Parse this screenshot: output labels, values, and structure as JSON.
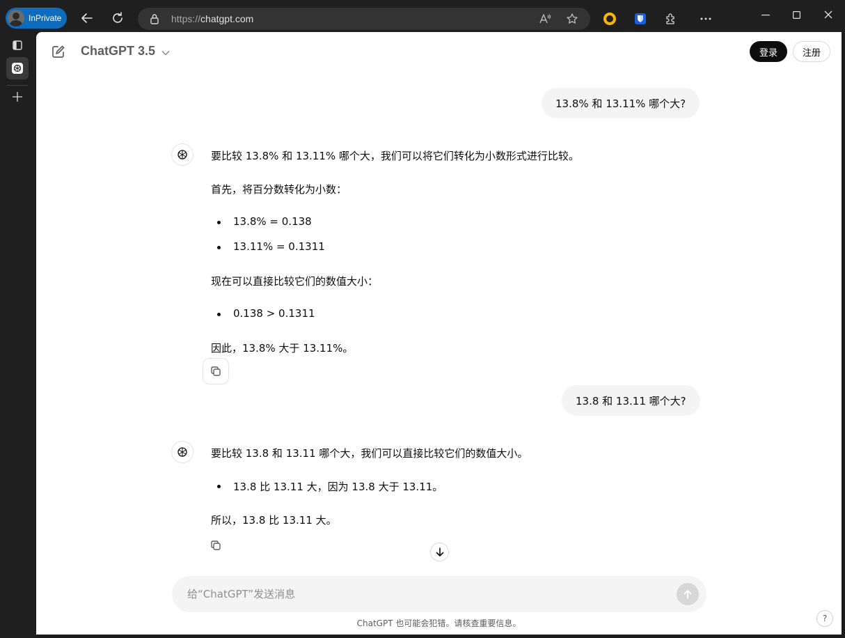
{
  "browser": {
    "mode_badge": "InPrivate",
    "url_scheme": "https://",
    "url_host": "chatgpt.com"
  },
  "header": {
    "model_label": "ChatGPT 3.5",
    "login_label": "登录",
    "signup_label": "注册"
  },
  "conversation": {
    "q1": "13.8% 和 13.11% 哪个大?",
    "a1_intro": "要比较 13.8% 和 13.11% 哪个大，我们可以将它们转化为小数形式进行比较。",
    "a1_step": "首先，将百分数转化为小数：",
    "a1_b1": "13.8% = 0.138",
    "a1_b2": "13.11% = 0.1311",
    "a1_compare": "现在可以直接比较它们的数值大小：",
    "a1_b3": "0.138 > 0.1311",
    "a1_conclusion": "因此，13.8% 大于 13.11%。",
    "q2": "13.8 和 13.11 哪个大?",
    "a2_intro": "要比较 13.8 和 13.11 哪个大，我们可以直接比较它们的数值大小。",
    "a2_b1": "13.8 比 13.11 大，因为 13.8 大于 13.11。",
    "a2_conclusion": "所以，13.8 比 13.11 大。"
  },
  "composer": {
    "placeholder": "给“ChatGPT”发送消息"
  },
  "footer": {
    "disclaimer": "ChatGPT 也可能会犯错。请核查重要信息。",
    "help_label": "?"
  }
}
